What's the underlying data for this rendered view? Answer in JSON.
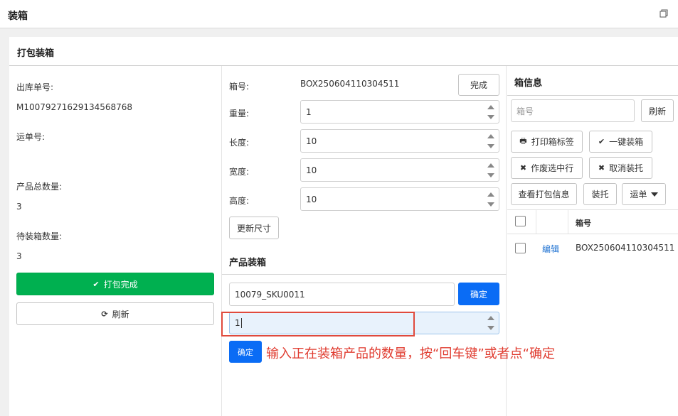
{
  "window": {
    "title": "装箱",
    "restore_icon": "restore-window-icon"
  },
  "panel": {
    "title": "打包装箱"
  },
  "left": {
    "outbound_label": "出库单号:",
    "outbound_value": "M10079271629134568768",
    "waybill_label": "运单号:",
    "waybill_value": "",
    "total_qty_label": "产品总数量:",
    "total_qty_value": "3",
    "pending_qty_label": "待装箱数量:",
    "pending_qty_value": "3",
    "pack_done_label": "打包完成",
    "refresh_label": "刷新"
  },
  "box_form": {
    "box_no_label": "箱号:",
    "box_no_value": "BOX250604110304511",
    "finish_label": "完成",
    "weight_label": "重量:",
    "weight_value": "1",
    "length_label": "长度:",
    "length_value": "10",
    "width_label": "宽度:",
    "width_value": "10",
    "height_label": "高度:",
    "height_value": "10",
    "update_size_label": "更新尺寸"
  },
  "product_pack": {
    "title": "产品装箱",
    "sku_value": "10079_SKU0011",
    "sku_confirm_label": "确定",
    "qty_value": "1",
    "qty_confirm_label": "确定",
    "hint": "输入正在装箱产品的数量，按“回车键”或者点“确定"
  },
  "box_info": {
    "title": "箱信息",
    "search_placeholder": "箱号",
    "refresh_label": "刷新",
    "print_label": "打印箱标签",
    "one_click_label": "一键装箱",
    "void_label": "作废选中行",
    "cancel_pallet_label": "取消装托",
    "view_pack_label": "查看打包信息",
    "pallet_label": "装托",
    "waybill_menu_label": "运单",
    "table": {
      "col_box_no": "箱号",
      "rows": [
        {
          "action": "编辑",
          "box_no": "BOX250604110304511"
        }
      ]
    }
  },
  "colors": {
    "green": "#00b050",
    "blue": "#0a6cf5",
    "annotation_red": "#e03c30",
    "link_blue": "#1a6fd1"
  }
}
